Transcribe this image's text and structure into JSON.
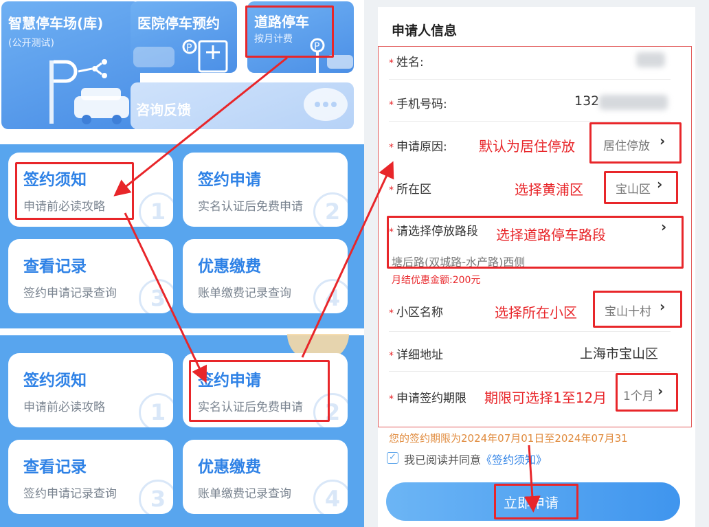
{
  "top_tiles": {
    "smart_parking": {
      "title": "智慧停车场(库)",
      "subtitle": "(公开测试)"
    },
    "hospital": {
      "title": "医院停车预约"
    },
    "road_parking": {
      "title": "道路停车",
      "subtitle": "按月计费"
    },
    "feedback": {
      "title": "咨询反馈"
    }
  },
  "cards_top": [
    {
      "title": "签约须知",
      "subtitle": "申请前必读攻略",
      "num": "1"
    },
    {
      "title": "签约申请",
      "subtitle": "实名认证后免费申请",
      "num": "2"
    },
    {
      "title": "查看记录",
      "subtitle": "签约申请记录查询",
      "num": "3"
    },
    {
      "title": "优惠缴费",
      "subtitle": "账单缴费记录查询",
      "num": "4"
    }
  ],
  "cards_bottom": [
    {
      "title": "签约须知",
      "subtitle": "申请前必读攻略",
      "num": "1"
    },
    {
      "title": "签约申请",
      "subtitle": "实名认证后免费申请",
      "num": "2"
    },
    {
      "title": "查看记录",
      "subtitle": "签约申请记录查询",
      "num": "3"
    },
    {
      "title": "优惠缴费",
      "subtitle": "账单缴费记录查询",
      "num": "4"
    }
  ],
  "form": {
    "title": "申请人信息",
    "star": "*",
    "name": {
      "label": "姓名:"
    },
    "phone": {
      "label": "手机号码:",
      "value": "132"
    },
    "reason": {
      "label": "申请原因:",
      "value": "居住停放",
      "annotation": "默认为居住停放"
    },
    "district": {
      "label": "所在区",
      "value": "宝山区",
      "annotation": "选择黄浦区"
    },
    "road": {
      "label": "请选择停放路段",
      "annotation": "选择道路停车路段",
      "value": "塘后路(双城路-水产路)西侧",
      "discount": "月结优惠金额:200元"
    },
    "community": {
      "label": "小区名称",
      "value": "宝山十村",
      "annotation": "选择所在小区"
    },
    "address": {
      "label": "详细地址",
      "value": "上海市宝山区"
    },
    "period": {
      "label": "申请签约期限",
      "value": "1个月",
      "annotation": "期限可选择1至12月"
    },
    "period_note": "您的签约期限为2024年07月01日至2024年07月31",
    "agree_prefix": "我已阅读并同意",
    "agree_link": "《签约须知》",
    "agree_checked": "✓",
    "submit": "立即申请",
    "chevron": "›"
  },
  "colors": {
    "annotation_red": "#e8262a",
    "brand_blue": "#2f82e6",
    "section_blue": "#58a5ee",
    "note_orange": "#e08a3c"
  }
}
